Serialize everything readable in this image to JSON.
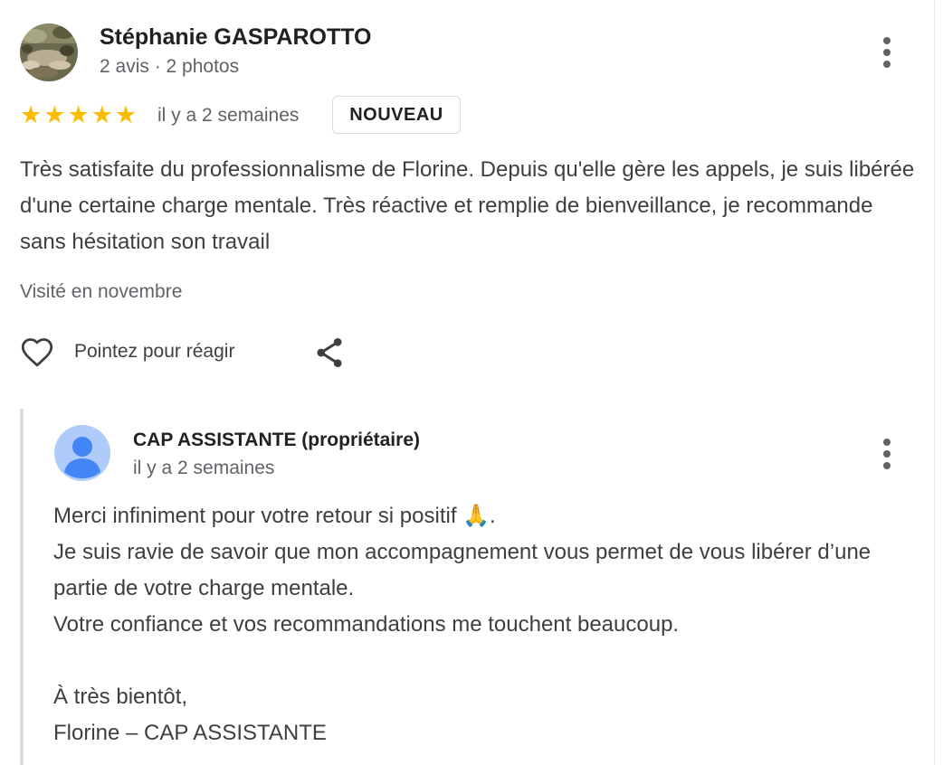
{
  "review": {
    "reviewer_name": "Stéphanie GASPAROTTO",
    "reviewer_meta": "2 avis · 2 photos",
    "rating": 5,
    "rating_max": 5,
    "stars": [
      "★",
      "★",
      "★",
      "★",
      "★"
    ],
    "time": "il y a 2 semaines",
    "badge": "NOUVEAU",
    "text": "Très satisfaite du professionnalisme de Florine. Depuis qu'elle gère les appels, je suis libérée d'une certaine charge mentale. Très réactive et remplie de bienveillance, je recommande sans hésitation son travail",
    "visited": "Visité en novembre",
    "react_label": "Pointez pour réagir"
  },
  "owner_reply": {
    "name": "CAP ASSISTANTE (propriétaire)",
    "time": "il y a 2 semaines",
    "lines": [
      "Merci infiniment pour votre retour si positif 🙏.",
      "Je suis ravie de savoir que mon accompagnement vous permet de vous libérer d’une partie de votre charge mentale.",
      "Votre confiance et vos recommandations me touchent beaucoup.",
      "",
      "À très bientôt,",
      "Florine – CAP ASSISTANTE"
    ]
  },
  "icons": {
    "more": "more-vert-icon",
    "like": "heart-outline-icon",
    "share": "share-icon",
    "star": "star-icon"
  },
  "colors": {
    "star": "#fbbc04",
    "text_primary": "#202124",
    "text_secondary": "#5f6368",
    "owner_avatar_bg": "#aecbfa",
    "owner_avatar_fg": "#4285f4",
    "reply_bar": "#dadce0"
  }
}
